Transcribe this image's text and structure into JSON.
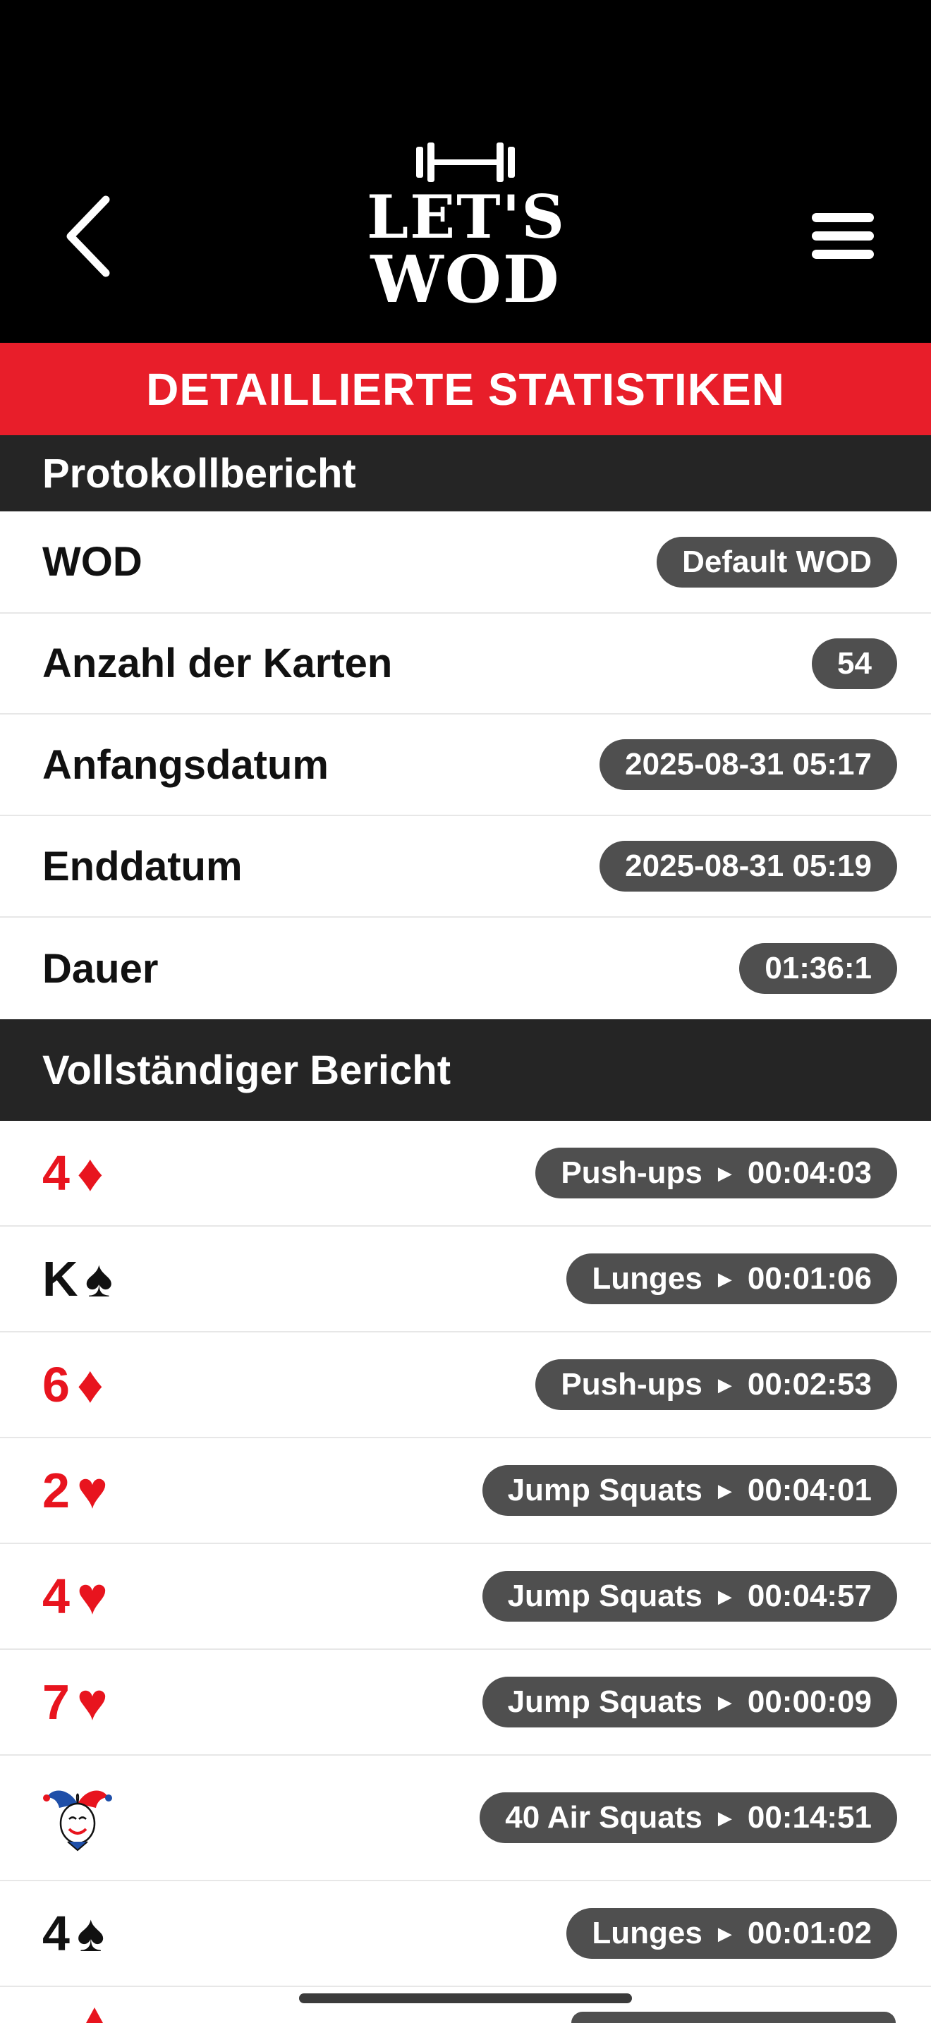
{
  "header": {
    "logo_line1": "LET'S",
    "logo_line2": "WOD"
  },
  "banner": {
    "title": "DETAILLIERTE STATISTIKEN"
  },
  "log_report": {
    "heading": "Protokollbericht",
    "rows": [
      {
        "label": "WOD",
        "value": "Default WOD"
      },
      {
        "label": "Anzahl der Karten",
        "value": "54"
      },
      {
        "label": "Anfangsdatum",
        "value": "2025-08-31 05:17"
      },
      {
        "label": "Enddatum",
        "value": "2025-08-31 05:19"
      },
      {
        "label": "Dauer",
        "value": "01:36:1"
      }
    ]
  },
  "full_report": {
    "heading": "Vollständiger Bericht",
    "cards": [
      {
        "rank": "4",
        "suit": "♦",
        "color": "#e8141e",
        "exercise": "Push-ups",
        "time": "00:04:03"
      },
      {
        "rank": "K",
        "suit": "♠",
        "color": "#111111",
        "exercise": "Lunges",
        "time": "00:01:06"
      },
      {
        "rank": "6",
        "suit": "♦",
        "color": "#e8141e",
        "exercise": "Push-ups",
        "time": "00:02:53"
      },
      {
        "rank": "2",
        "suit": "♥",
        "color": "#e8141e",
        "exercise": "Jump Squats",
        "time": "00:04:01"
      },
      {
        "rank": "4",
        "suit": "♥",
        "color": "#e8141e",
        "exercise": "Jump Squats",
        "time": "00:04:57"
      },
      {
        "rank": "7",
        "suit": "♥",
        "color": "#e8141e",
        "exercise": "Jump Squats",
        "time": "00:00:09"
      },
      {
        "rank": "",
        "suit": "",
        "icon": "joker-icon",
        "color": "#111111",
        "exercise": "40 Air Squats",
        "time": "00:14:51"
      },
      {
        "rank": "4",
        "suit": "♠",
        "color": "#111111",
        "exercise": "Lunges",
        "time": "00:01:02"
      }
    ]
  },
  "colors": {
    "accent_red": "#e81e2a",
    "header_black": "#000000",
    "section_dark": "#252525",
    "pill_gray": "#4f4f4f"
  }
}
